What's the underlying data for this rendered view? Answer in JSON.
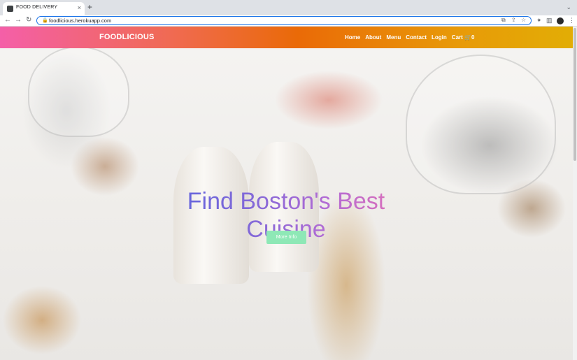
{
  "browser": {
    "tab_title": "FOOD DELIVERY",
    "tab_close": "×",
    "new_tab": "+",
    "url": "foodlicious.herokuapp.com"
  },
  "site": {
    "brand": "FOODLICIOUS",
    "nav": [
      "Home",
      "About",
      "Menu",
      "Contact",
      "Login"
    ],
    "cart_label": "Cart",
    "cart_count": "0",
    "gradient_colors": [
      "#f45fa8",
      "#ea6a07",
      "#e2ad05"
    ]
  },
  "hero": {
    "title": "Find Boston's Best Cuisine",
    "button_label": "More Info",
    "button_color": "#8ee8b6"
  },
  "icons": {
    "back": "←",
    "forward": "→",
    "reload": "↻",
    "lock": "🔒",
    "cart": "🛒",
    "chevron": "⌄",
    "star": "☆",
    "menu": "⋮"
  }
}
